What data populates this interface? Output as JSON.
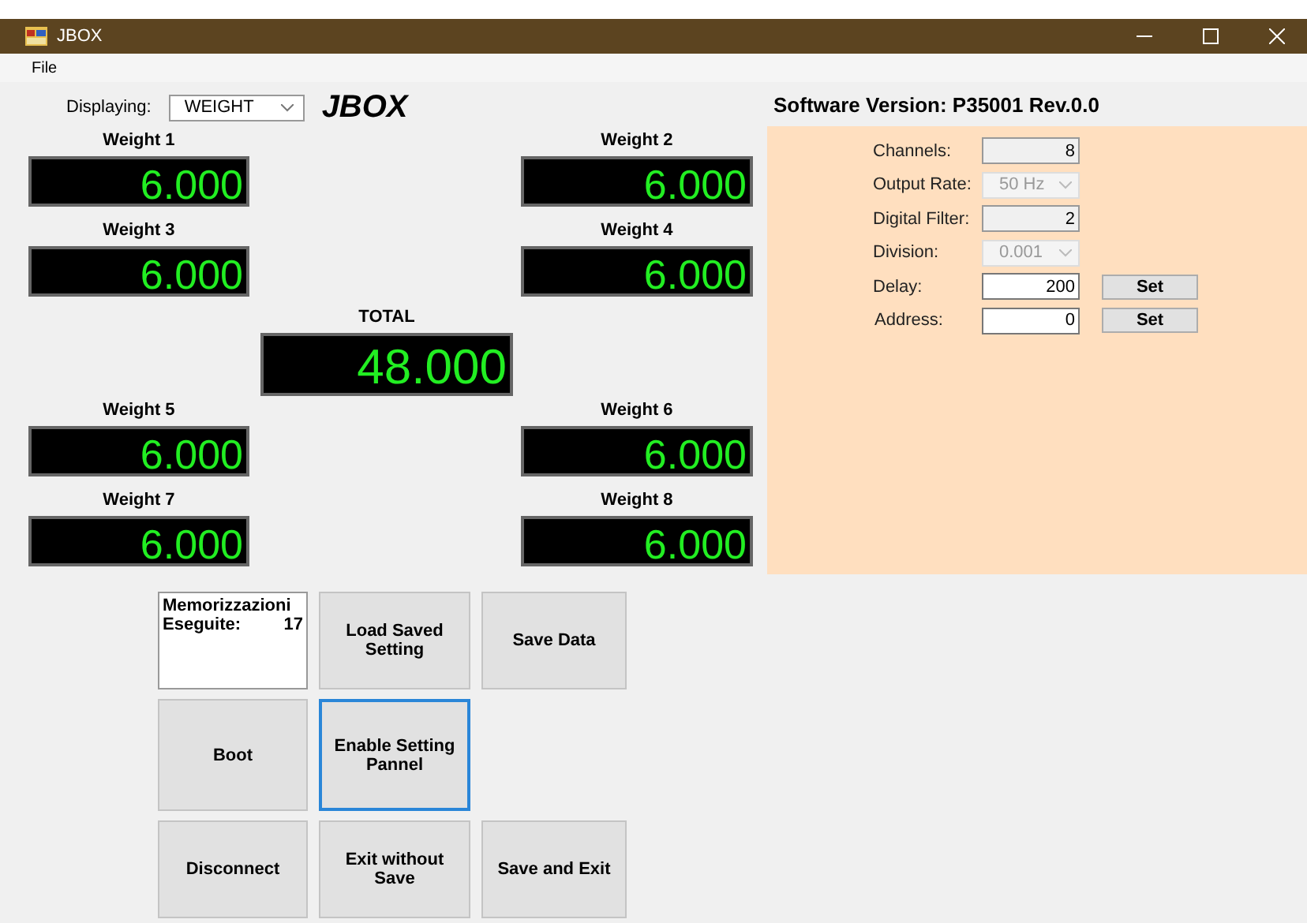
{
  "window": {
    "title": "JBOX"
  },
  "menu": [
    "File"
  ],
  "display": {
    "label": "Displaying:",
    "value": "WEIGHT",
    "logo": "JBOX"
  },
  "weights": [
    {
      "label": "Weight 1",
      "value": "6.000"
    },
    {
      "label": "Weight 2",
      "value": "6.000"
    },
    {
      "label": "Weight 3",
      "value": "6.000"
    },
    {
      "label": "Weight 4",
      "value": "6.000"
    },
    {
      "label": "Weight 5",
      "value": "6.000"
    },
    {
      "label": "Weight 6",
      "value": "6.000"
    },
    {
      "label": "Weight 7",
      "value": "6.000"
    },
    {
      "label": "Weight 8",
      "value": "6.000"
    }
  ],
  "total": {
    "label": "TOTAL",
    "value": "48.000"
  },
  "counter": {
    "title": "Memorizzazioni",
    "label": "Eseguite:",
    "value": "17"
  },
  "buttons": [
    {
      "label": "Load Saved Setting",
      "focused": false
    },
    {
      "label": "Save Data",
      "focused": false
    },
    {
      "label": "Boot",
      "focused": false
    },
    {
      "label": "Enable Setting Pannel",
      "focused": true
    },
    {
      "label": "Disconnect",
      "focused": false
    },
    {
      "label": "Exit without Save",
      "focused": false
    },
    {
      "label": "Save and Exit",
      "focused": false
    }
  ],
  "settings": {
    "version": "Software Version: P35001 Rev.0.0",
    "fields": [
      {
        "kind": "readonly",
        "label": "Channels:",
        "value": "8"
      },
      {
        "kind": "dropdown",
        "label": "Output Rate:",
        "value": "50 Hz"
      },
      {
        "kind": "readonly",
        "label": "Digital Filter:",
        "value": "2"
      },
      {
        "kind": "dropdown",
        "label": "Division:",
        "value": "0.001"
      },
      {
        "kind": "input",
        "label": "Delay:",
        "value": "200",
        "action": "Set"
      },
      {
        "kind": "input",
        "label": "Address:",
        "value": "0",
        "action": "Set"
      }
    ]
  }
}
